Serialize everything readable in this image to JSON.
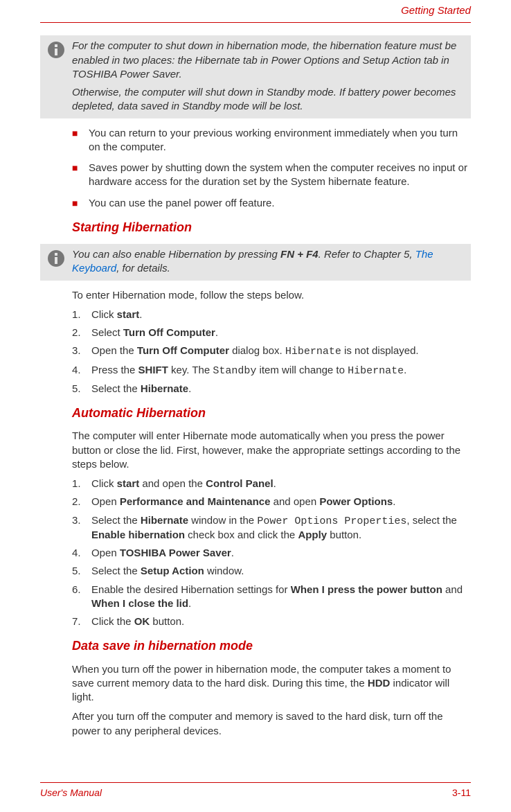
{
  "header": {
    "section": "Getting Started"
  },
  "note1": {
    "p1": "For the computer to shut down in hibernation mode, the hibernation feature must be enabled in two places: the Hibernate tab in Power Options and Setup Action tab in TOSHIBA Power Saver.",
    "p2": "Otherwise, the computer will shut down in Standby mode. If battery power becomes depleted, data saved in Standby mode will be lost."
  },
  "bullets1": [
    "You can return to your previous working environment immediately when you turn on the computer.",
    "Saves power by shutting down the system when the computer receives no input or hardware access for the duration set by the System hibernate feature.",
    "You can use the panel power off feature."
  ],
  "heading1": "Starting Hibernation",
  "note2": {
    "pre": "You can also enable Hibernation by pressing ",
    "keys": "FN + F4",
    "mid": ". Refer to Chapter 5, ",
    "link": "The Keyboard",
    "post": ", for details."
  },
  "para1": "To enter Hibernation mode, follow the steps below.",
  "steps1": {
    "s1_a": "Click ",
    "s1_b": "start",
    "s1_c": ".",
    "s2_a": "Select ",
    "s2_b": "Turn Off Computer",
    "s2_c": ".",
    "s3_a": "Open the ",
    "s3_b": "Turn Off Computer",
    "s3_c": " dialog box. ",
    "s3_d": "Hibernate",
    "s3_e": " is not displayed.",
    "s4_a": "Press the ",
    "s4_b": "SHIFT",
    "s4_c": " key. The ",
    "s4_d": "Standby",
    "s4_e": " item will change to ",
    "s4_f": "Hibernate",
    "s4_g": ".",
    "s5_a": "Select the ",
    "s5_b": "Hibernate",
    "s5_c": "."
  },
  "heading2": "Automatic Hibernation",
  "para2": "The computer will enter Hibernate mode automatically when you press the power button or close the lid. First, however, make the appropriate settings according to the steps below.",
  "steps2": {
    "s1_a": "Click ",
    "s1_b": "start",
    "s1_c": " and open the ",
    "s1_d": "Control Panel",
    "s1_e": ".",
    "s2_a": "Open ",
    "s2_b": "Performance and Maintenance",
    "s2_c": " and open ",
    "s2_d": "Power Options",
    "s2_e": ".",
    "s3_a": "Select the ",
    "s3_b": "Hibernate",
    "s3_c": " window in the ",
    "s3_d": "Power Options Properties",
    "s3_e": ", select the ",
    "s3_f": "Enable hibernation",
    "s3_g": " check box and click the ",
    "s3_h": "Apply",
    "s3_i": " button.",
    "s4_a": "Open ",
    "s4_b": "TOSHIBA Power Saver",
    "s4_c": ".",
    "s5_a": "Select the ",
    "s5_b": "Setup Action",
    "s5_c": " window.",
    "s6_a": "Enable the desired Hibernation settings for ",
    "s6_b": "When I press the power button",
    "s6_c": " and ",
    "s6_d": "When I close the lid",
    "s6_e": ".",
    "s7_a": "Click the ",
    "s7_b": "OK",
    "s7_c": " button."
  },
  "heading3": "Data save in hibernation mode",
  "para3_a": "When you turn off the power in hibernation mode, the computer takes a moment to save current memory data to the hard disk. During this time, the ",
  "para3_b": "HDD",
  "para3_c": " indicator will light.",
  "para4": "After you turn off the computer and memory is saved to the hard disk, turn off the power to any peripheral devices.",
  "footer": {
    "left": "User's Manual",
    "right": "3-11"
  }
}
